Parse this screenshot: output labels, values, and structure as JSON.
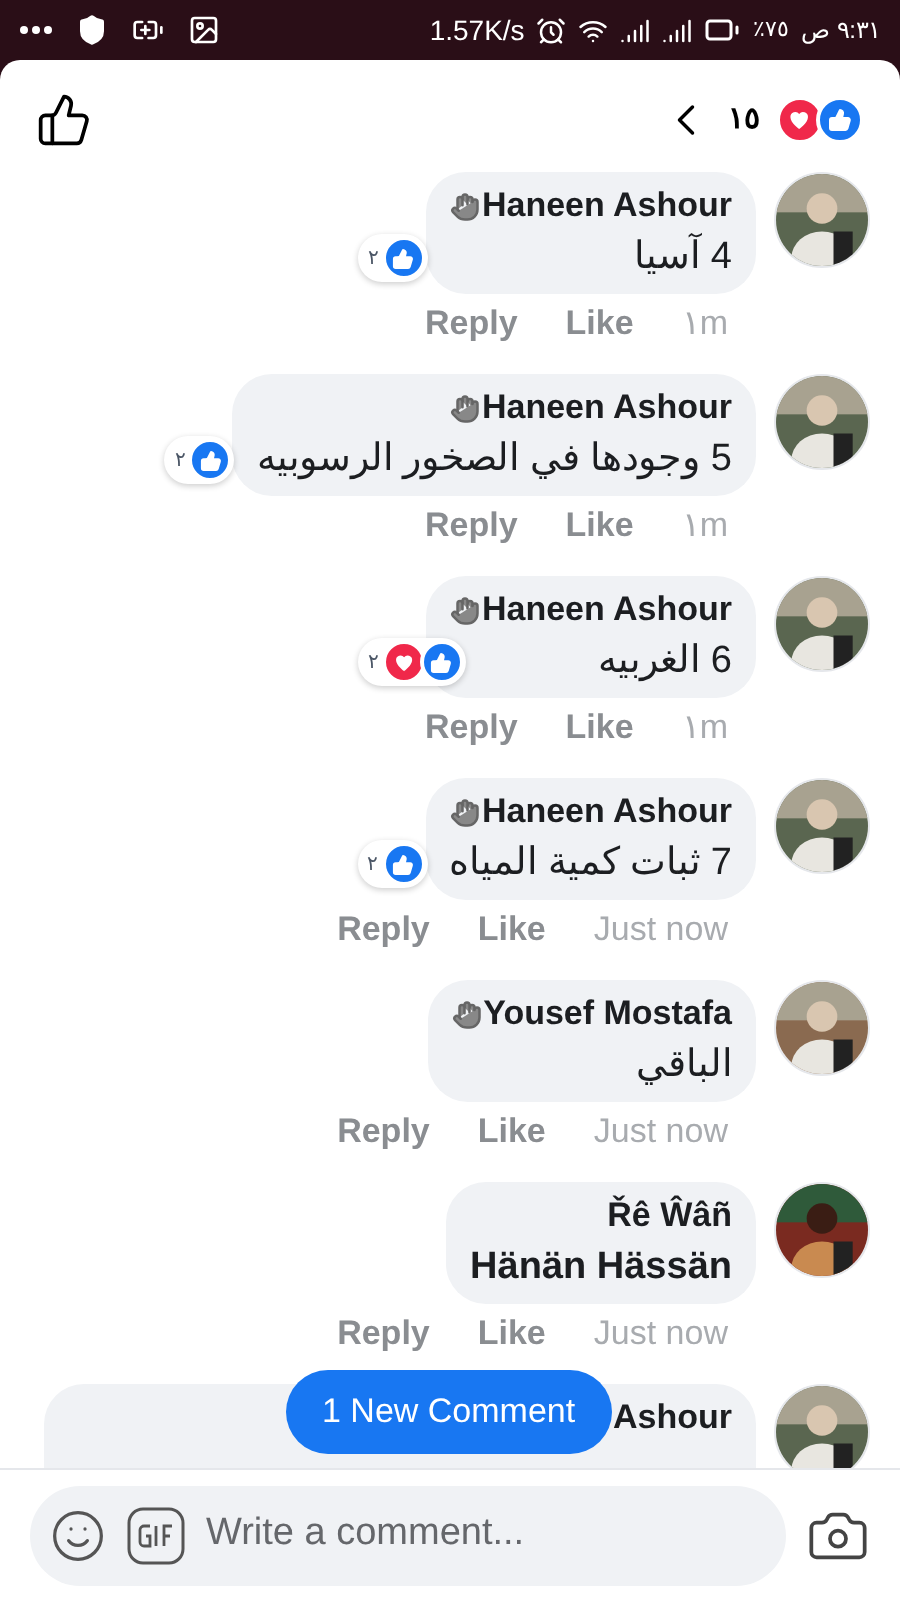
{
  "status_bar": {
    "speed": "1.57K/s",
    "battery": "٪٧٥",
    "time": "٩:٣١ ص"
  },
  "header": {
    "reactions": [
      {
        "kind": "like"
      },
      {
        "kind": "love"
      }
    ],
    "count": "١٥"
  },
  "comments": [
    {
      "author": "Haneen Ashour",
      "waving": true,
      "text": "4 آسيا",
      "reactions": [
        {
          "kind": "like"
        }
      ],
      "reaction_count": "٢",
      "actions": [
        "Reply",
        "Like"
      ],
      "time": "١m"
    },
    {
      "author": "Haneen Ashour",
      "waving": true,
      "text": "5 وجودها في الصخور الرسوبيه",
      "reactions": [
        {
          "kind": "like"
        }
      ],
      "reaction_count": "٢",
      "actions": [
        "Reply",
        "Like"
      ],
      "time": "١m"
    },
    {
      "author": "Haneen Ashour",
      "waving": true,
      "text": "6 الغربيه",
      "reactions": [
        {
          "kind": "like"
        },
        {
          "kind": "love"
        }
      ],
      "reaction_count": "٢",
      "actions": [
        "Reply",
        "Like"
      ],
      "time": "١m"
    },
    {
      "author": "Haneen Ashour",
      "waving": true,
      "text": "7 ثبات كمية المياه",
      "reactions": [
        {
          "kind": "like"
        }
      ],
      "reaction_count": "٢",
      "actions": [
        "Reply",
        "Like"
      ],
      "time": "Just now"
    },
    {
      "author": "Yousef Mostafa",
      "waving": true,
      "text": "الباقي",
      "actions": [
        "Reply",
        "Like"
      ],
      "time": "Just now"
    },
    {
      "author": "Řê Ŵâñ",
      "waving": false,
      "text": "Hänän Hässän",
      "text_bold": true,
      "actions": [
        "Reply",
        "Like"
      ],
      "time": "Just now"
    },
    {
      "author": "Ashour",
      "waving": false
    }
  ],
  "new_comment_button": "1 New Comment",
  "composer": {
    "placeholder": "Write a comment..."
  }
}
